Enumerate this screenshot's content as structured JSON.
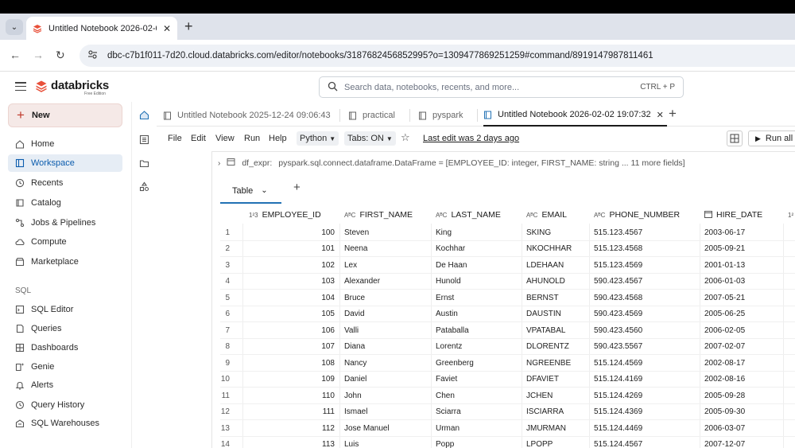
{
  "browser": {
    "tab_title": "Untitled Notebook 2026-02-02",
    "tab_close": "✕",
    "new_tab": "+",
    "url": "dbc-c7b1f011-7d20.cloud.databricks.com/editor/notebooks/3187682456852995?o=1309477869251259#command/8919147987811461"
  },
  "header": {
    "logo_text": "databricks",
    "logo_sub": "Free Edition",
    "search_placeholder": "Search data, notebooks, recents, and more...",
    "search_shortcut": "CTRL + P"
  },
  "sidebar": {
    "new_label": "New",
    "items": [
      {
        "label": "Home",
        "icon": "home-icon"
      },
      {
        "label": "Workspace",
        "icon": "workspace-icon"
      },
      {
        "label": "Recents",
        "icon": "clock-icon"
      },
      {
        "label": "Catalog",
        "icon": "catalog-icon"
      },
      {
        "label": "Jobs & Pipelines",
        "icon": "jobs-icon"
      },
      {
        "label": "Compute",
        "icon": "cloud-icon"
      },
      {
        "label": "Marketplace",
        "icon": "store-icon"
      }
    ],
    "sql_heading": "SQL",
    "sql_items": [
      {
        "label": "SQL Editor",
        "icon": "sql-editor-icon"
      },
      {
        "label": "Queries",
        "icon": "queries-icon"
      },
      {
        "label": "Dashboards",
        "icon": "dashboards-icon"
      },
      {
        "label": "Genie",
        "icon": "genie-icon"
      },
      {
        "label": "Alerts",
        "icon": "bell-icon"
      },
      {
        "label": "Query History",
        "icon": "history-icon"
      },
      {
        "label": "SQL Warehouses",
        "icon": "warehouse-icon"
      }
    ]
  },
  "notebook_tabs": [
    {
      "label": "Untitled Notebook 2025-12-24 09:06:43"
    },
    {
      "label": "practical"
    },
    {
      "label": "pyspark"
    },
    {
      "label": "Untitled Notebook 2026-02-02 19:07:32"
    }
  ],
  "menu": {
    "file": "File",
    "edit": "Edit",
    "view": "View",
    "run": "Run",
    "help": "Help",
    "language": "Python",
    "tabs": "Tabs: ON",
    "last_edit": "Last edit was 2 days ago",
    "run_all": "Run all"
  },
  "cell": {
    "df_line_name": "df_expr:",
    "df_line_type": "pyspark.sql.connect.dataframe.DataFrame = [EMPLOYEE_ID: integer, FIRST_NAME: string ... 11 more fields]",
    "result_tab": "Table",
    "add_tab": "+"
  },
  "table": {
    "columns": [
      {
        "name": "EMPLOYEE_ID",
        "type": "1²3"
      },
      {
        "name": "FIRST_NAME",
        "type": "AᴮC"
      },
      {
        "name": "LAST_NAME",
        "type": "AᴮC"
      },
      {
        "name": "EMAIL",
        "type": "AᴮC"
      },
      {
        "name": "PHONE_NUMBER",
        "type": "AᴮC"
      },
      {
        "name": "HIRE_DATE",
        "type": "cal"
      }
    ],
    "rows": [
      [
        "1",
        "100",
        "Steven",
        "King",
        "SKING",
        "515.123.4567",
        "2003-06-17"
      ],
      [
        "2",
        "101",
        "Neena",
        "Kochhar",
        "NKOCHHAR",
        "515.123.4568",
        "2005-09-21"
      ],
      [
        "3",
        "102",
        "Lex",
        "De Haan",
        "LDEHAAN",
        "515.123.4569",
        "2001-01-13"
      ],
      [
        "4",
        "103",
        "Alexander",
        "Hunold",
        "AHUNOLD",
        "590.423.4567",
        "2006-01-03"
      ],
      [
        "5",
        "104",
        "Bruce",
        "Ernst",
        "BERNST",
        "590.423.4568",
        "2007-05-21"
      ],
      [
        "6",
        "105",
        "David",
        "Austin",
        "DAUSTIN",
        "590.423.4569",
        "2005-06-25"
      ],
      [
        "7",
        "106",
        "Valli",
        "Pataballa",
        "VPATABAL",
        "590.423.4560",
        "2006-02-05"
      ],
      [
        "8",
        "107",
        "Diana",
        "Lorentz",
        "DLORENTZ",
        "590.423.5567",
        "2007-02-07"
      ],
      [
        "9",
        "108",
        "Nancy",
        "Greenberg",
        "NGREENBE",
        "515.124.4569",
        "2002-08-17"
      ],
      [
        "10",
        "109",
        "Daniel",
        "Faviet",
        "DFAVIET",
        "515.124.4169",
        "2002-08-16"
      ],
      [
        "11",
        "110",
        "John",
        "Chen",
        "JCHEN",
        "515.124.4269",
        "2005-09-28"
      ],
      [
        "12",
        "111",
        "Ismael",
        "Sciarra",
        "ISCIARRA",
        "515.124.4369",
        "2005-09-30"
      ],
      [
        "13",
        "112",
        "Jose Manuel",
        "Urman",
        "JMURMAN",
        "515.124.4469",
        "2006-03-07"
      ],
      [
        "14",
        "113",
        "Luis",
        "Popp",
        "LPOPP",
        "515.124.4567",
        "2007-12-07"
      ]
    ]
  }
}
